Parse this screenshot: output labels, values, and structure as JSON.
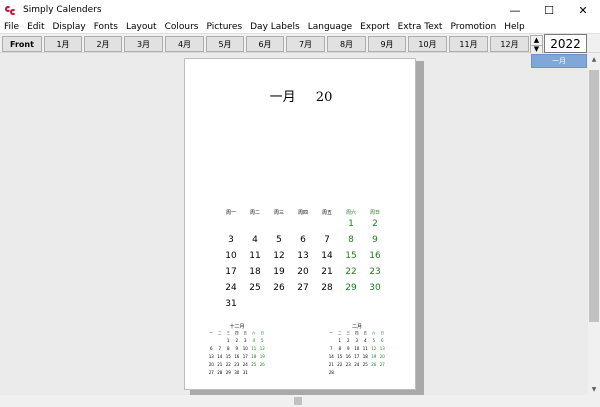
{
  "window": {
    "title": "Simply Calenders",
    "minimize": "—",
    "maximize": "☐",
    "close": "✕"
  },
  "menu": [
    "File",
    "Edit",
    "Display",
    "Fonts",
    "Layout",
    "Colours",
    "Pictures",
    "Day Labels",
    "Language",
    "Export",
    "Extra Text",
    "Promotion",
    "Help"
  ],
  "toolbar": {
    "front": "Front",
    "months": [
      "1月",
      "2月",
      "3月",
      "4月",
      "5月",
      "6月",
      "7月",
      "8月",
      "9月",
      "10月",
      "11月",
      "12月"
    ],
    "spin_up": "▲",
    "spin_down": "▼",
    "year": "2022",
    "selected_month": "一月"
  },
  "scrollbar": {
    "up": "▲",
    "down": "▼"
  },
  "page": {
    "month_name": "一月",
    "year_short": "20",
    "weekday_labels": [
      "周一",
      "周二",
      "周三",
      "周四",
      "周五",
      "周六",
      "周日"
    ],
    "weeks": [
      [
        "",
        "",
        "",
        "",
        "",
        "1",
        "2"
      ],
      [
        "3",
        "4",
        "5",
        "6",
        "7",
        "8",
        "9"
      ],
      [
        "10",
        "11",
        "12",
        "13",
        "14",
        "15",
        "16"
      ],
      [
        "17",
        "18",
        "19",
        "20",
        "21",
        "22",
        "23"
      ],
      [
        "24",
        "25",
        "26",
        "27",
        "28",
        "29",
        "30"
      ],
      [
        "31",
        "",
        "",
        "",
        "",
        "",
        ""
      ]
    ],
    "prev_month": {
      "title": "十二月",
      "weekday_labels": [
        "一",
        "二",
        "三",
        "四",
        "五",
        "六",
        "日"
      ],
      "weeks": [
        [
          "",
          "",
          "1",
          "2",
          "3",
          "4",
          "5"
        ],
        [
          "6",
          "7",
          "8",
          "9",
          "10",
          "11",
          "12"
        ],
        [
          "13",
          "14",
          "15",
          "16",
          "17",
          "18",
          "19"
        ],
        [
          "20",
          "21",
          "22",
          "23",
          "24",
          "25",
          "26"
        ],
        [
          "27",
          "28",
          "29",
          "30",
          "31",
          "",
          ""
        ]
      ]
    },
    "next_month": {
      "title": "二月",
      "weekday_labels": [
        "一",
        "二",
        "三",
        "四",
        "五",
        "六",
        "日"
      ],
      "weeks": [
        [
          "",
          "1",
          "2",
          "3",
          "4",
          "5",
          "6"
        ],
        [
          "7",
          "8",
          "9",
          "10",
          "11",
          "12",
          "13"
        ],
        [
          "14",
          "15",
          "16",
          "17",
          "18",
          "19",
          "20"
        ],
        [
          "21",
          "22",
          "23",
          "24",
          "25",
          "26",
          "27"
        ],
        [
          "28",
          "",
          "",
          "",
          "",
          "",
          ""
        ]
      ]
    }
  },
  "colors": {
    "weekend": "#1a7f1a",
    "selection": "#7fa8d8"
  }
}
